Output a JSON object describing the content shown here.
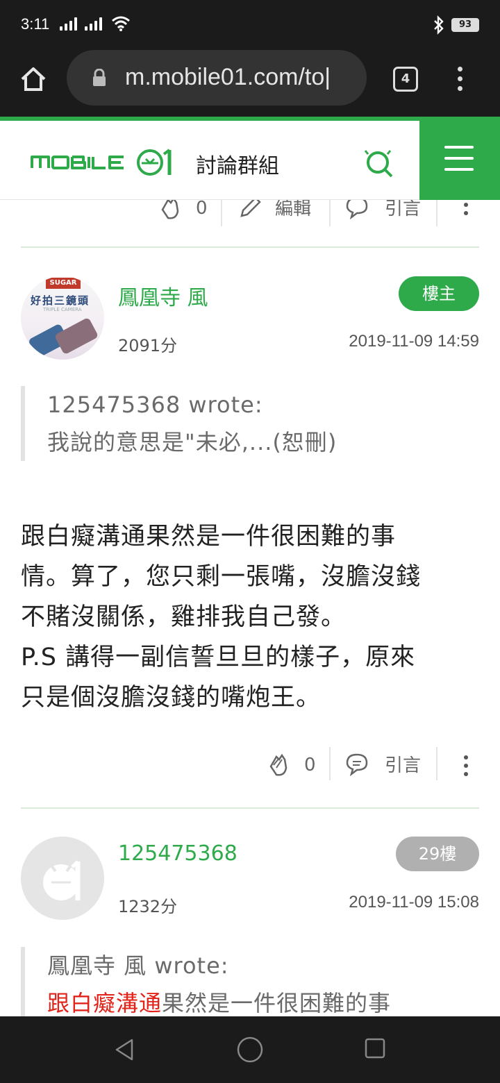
{
  "status_bar": {
    "time": "3:11",
    "battery": "93"
  },
  "browser": {
    "url": "m.mobile01.com/to|",
    "tab_count": "4"
  },
  "site_header": {
    "title": "討論群組"
  },
  "prev_actions": {
    "like_count": "0",
    "edit_label": "編輯",
    "quote_label": "引言"
  },
  "posts": [
    {
      "username": "鳳凰寺 風",
      "badge": "樓主",
      "score": "2091分",
      "datetime": "2019-11-09 14:59",
      "avatar": {
        "brand": "SUGAR",
        "caption": "好拍三鏡頭",
        "sub": "TRIPLE CAMERA"
      },
      "quote": {
        "author_line": "125475368 wrote:",
        "text": "我說的意思是\"未必,...(恕刪)"
      },
      "body": [
        "跟白癡溝通果然是一件很困難的事",
        "情。算了，您只剩一張嘴，沒膽沒錢",
        "不賭沒關係，雞排我自己發。",
        "P.S 講得一副信誓旦旦的樣子，原來",
        "只是個沒膽沒錢的嘴炮王。"
      ],
      "like_count": "0",
      "quote_label": "引言"
    },
    {
      "username": "125475368",
      "badge": "29樓",
      "score": "1232分",
      "datetime": "2019-11-09 15:08",
      "quote": {
        "author_line": "鳳凰寺 風 wrote:",
        "highlight": "跟白癡溝通",
        "rest": "果然是一件很困難的事"
      }
    }
  ],
  "colors": {
    "brand_green": "#2eaa4a",
    "highlight_red": "#e2231a",
    "badge_gray": "#b0b0b0"
  }
}
